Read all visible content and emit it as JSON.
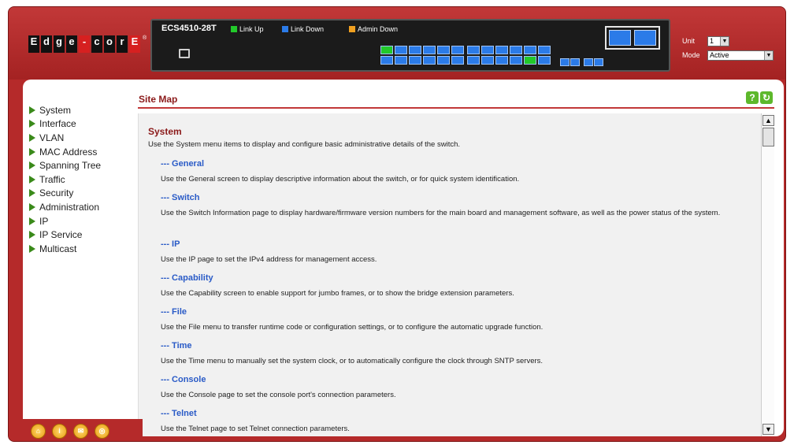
{
  "brand": {
    "logo_letters": [
      "E",
      "d",
      "g",
      "e",
      "-",
      "c",
      "o",
      "r",
      "E"
    ]
  },
  "device": {
    "model": "ECS4510-28T",
    "legend": [
      {
        "label": "Link Up",
        "color": "#22c92a"
      },
      {
        "label": "Link Down",
        "color": "#2b7be8"
      },
      {
        "label": "Admin Down",
        "color": "#f0a020"
      }
    ]
  },
  "unit": {
    "label": "Unit",
    "value": "1"
  },
  "mode": {
    "label": "Mode",
    "value": "Active"
  },
  "sidebar": {
    "items": [
      {
        "label": "System"
      },
      {
        "label": "Interface"
      },
      {
        "label": "VLAN"
      },
      {
        "label": "MAC Address"
      },
      {
        "label": "Spanning Tree"
      },
      {
        "label": "Traffic"
      },
      {
        "label": "Security"
      },
      {
        "label": "Administration"
      },
      {
        "label": "IP"
      },
      {
        "label": "IP Service"
      },
      {
        "label": "Multicast"
      }
    ]
  },
  "page": {
    "title": "Site Map",
    "help_glyph": "?",
    "refresh_glyph": "↻"
  },
  "sitemap": {
    "section_title": "System",
    "section_desc": "Use the System menu items to display and configure basic administrative details of the switch.",
    "entries": [
      {
        "name": "--- General",
        "desc": "Use the General screen to display descriptive information about the switch, or for quick system identification."
      },
      {
        "name": "--- Switch",
        "desc": "Use the Switch Information page to display hardware/firmware version numbers for the main board and management software, as well as the power status of the system."
      },
      {
        "name": "--- IP",
        "desc": "Use the IP page to set the IPv4 address for management access."
      },
      {
        "name": "--- Capability",
        "desc": "Use the Capability screen to enable support for jumbo frames, or to show the bridge extension parameters."
      },
      {
        "name": "--- File",
        "desc": "Use the File menu to transfer runtime code or configuration settings, or to configure the automatic upgrade function."
      },
      {
        "name": "--- Time",
        "desc": "Use the Time menu to manually set the system clock, or to automatically configure the clock through SNTP servers."
      },
      {
        "name": "--- Console",
        "desc": "Use the Console page to set the console port's connection parameters."
      },
      {
        "name": "--- Telnet",
        "desc": "Use the Telnet page to set Telnet connection parameters."
      }
    ]
  }
}
